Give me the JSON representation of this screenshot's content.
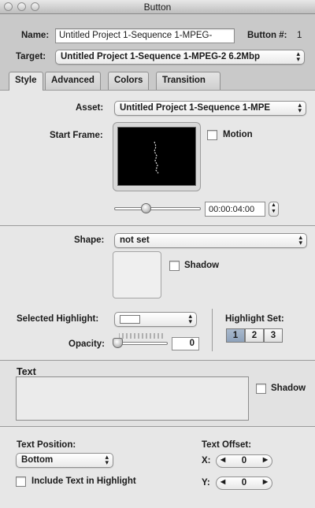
{
  "window": {
    "title": "Button"
  },
  "header": {
    "name_label": "Name:",
    "name_value": "Untitled Project 1-Sequence 1-MPEG-",
    "button_num_label": "Button #:",
    "button_num_value": "1",
    "target_label": "Target:",
    "target_value": "Untitled Project 1-Sequence 1-MPEG-2 6.2Mbp"
  },
  "tabs": [
    {
      "label": "Style",
      "active": true
    },
    {
      "label": "Advanced",
      "active": false
    },
    {
      "label": "Colors",
      "active": false
    },
    {
      "label": "Transition",
      "active": false
    }
  ],
  "asset": {
    "label": "Asset:",
    "value": "Untitled Project 1-Sequence 1-MPE",
    "start_frame_label": "Start Frame:",
    "motion_label": "Motion",
    "timecode": "00:00:04:00"
  },
  "shape": {
    "label": "Shape:",
    "value": "not set",
    "shadow_label": "Shadow",
    "selected_highlight_label": "Selected Highlight:",
    "opacity_label": "Opacity:",
    "opacity_value": "0",
    "highlight_set_label": "Highlight Set:",
    "highlight_set_options": [
      "1",
      "2",
      "3"
    ],
    "highlight_set_selected": "1"
  },
  "text": {
    "heading": "Text",
    "shadow_label": "Shadow"
  },
  "text_position": {
    "label": "Text Position:",
    "value": "Bottom",
    "include_label": "Include Text in Highlight",
    "offset_label": "Text Offset:",
    "x_label": "X:",
    "x_value": "0",
    "y_label": "Y:",
    "y_value": "0"
  },
  "colors": {
    "highlight_selected": "#8ea2bb",
    "preview_bg": "#000000"
  }
}
